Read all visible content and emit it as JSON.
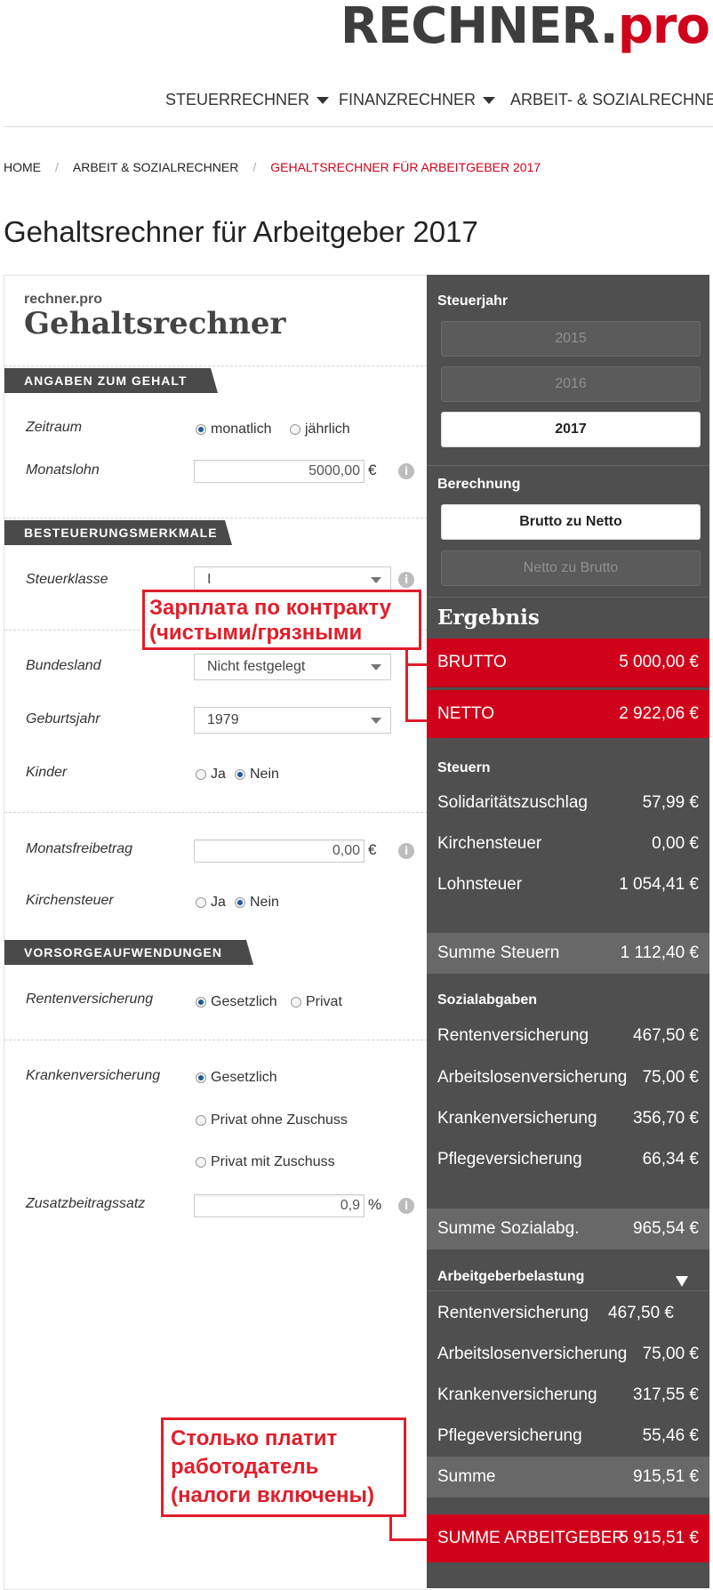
{
  "logo": {
    "dark": "RECHNER.",
    "red": "pro"
  },
  "nav": {
    "items": [
      "STEUERRECHNER",
      "FINANZRECHNER",
      "ARBEIT- & SOZIALRECHNER"
    ]
  },
  "breadcrumb": {
    "home": "HOME",
    "parent": "ARBEIT & SOZIALRECHNER",
    "current": "GEHALTSRECHNER FÜR ARBEITGEBER 2017"
  },
  "page_title": "Gehaltsrechner für Arbeitgeber 2017",
  "form": {
    "brand_small": "rechner.pro",
    "brand_big": "Gehaltsrechner",
    "sections": {
      "gehalt": "ANGABEN ZUM GEHALT",
      "besteuerung": "BESTEUERUNGSMERKMALE",
      "vorsorge": "VORSORGEAUFWENDUNGEN"
    },
    "zeitraum": {
      "label": "Zeitraum",
      "opt1": "monatlich",
      "opt2": "jährlich",
      "selected": "monatlich"
    },
    "monatslohn": {
      "label": "Monatslohn",
      "value": "5000,00",
      "unit": "€"
    },
    "steuerklasse": {
      "label": "Steuerklasse",
      "value": "I"
    },
    "bundesland": {
      "label": "Bundesland",
      "value": "Nicht festgelegt"
    },
    "geburtsjahr": {
      "label": "Geburtsjahr",
      "value": "1979"
    },
    "kinder": {
      "label": "Kinder",
      "opt1": "Ja",
      "opt2": "Nein",
      "selected": "Nein"
    },
    "monatsfreibetrag": {
      "label": "Monatsfreibetrag",
      "value": "0,00",
      "unit": "€"
    },
    "kirchensteuer": {
      "label": "Kirchensteuer",
      "opt1": "Ja",
      "opt2": "Nein",
      "selected": "Nein"
    },
    "renten": {
      "label": "Rentenversicherung",
      "opt1": "Gesetzlich",
      "opt2": "Privat",
      "selected": "Gesetzlich"
    },
    "kranken": {
      "label": "Krankenversicherung",
      "opt1": "Gesetzlich",
      "opt2": "Privat ohne Zuschuss",
      "opt3": "Privat mit Zuschuss",
      "selected": "Gesetzlich"
    },
    "zusatz": {
      "label": "Zusatzbeitragssatz",
      "value": "0,9",
      "unit": "%"
    },
    "info_glyph": "i"
  },
  "result": {
    "steuerjahr_label": "Steuerjahr",
    "years": [
      "2015",
      "2016",
      "2017"
    ],
    "selected_year": "2017",
    "berechnung_label": "Berechnung",
    "calc_options": [
      "Brutto zu Netto",
      "Netto zu Brutto"
    ],
    "selected_calc": "Brutto zu Netto",
    "ergebnis_label": "Ergebnis",
    "brutto": {
      "label": "BRUTTO",
      "value": "5 000,00 €"
    },
    "netto": {
      "label": "NETTO",
      "value": "2 922,06 €"
    },
    "steuern": {
      "title": "Steuern",
      "rows": [
        {
          "label": "Solidaritätszuschlag",
          "value": "57,99 €"
        },
        {
          "label": "Kirchensteuer",
          "value": "0,00 €"
        },
        {
          "label": "Lohnsteuer",
          "value": "1 054,41 €"
        }
      ],
      "sum": {
        "label": "Summe Steuern",
        "value": "1 112,40 €"
      }
    },
    "sozial": {
      "title": "Sozialabgaben",
      "rows": [
        {
          "label": "Rentenversicherung",
          "value": "467,50 €"
        },
        {
          "label": "Arbeitslosenversicherung",
          "value": "75,00 €"
        },
        {
          "label": "Krankenversicherung",
          "value": "356,70 €"
        },
        {
          "label": "Pflegeversicherung",
          "value": "66,34 €"
        }
      ],
      "sum": {
        "label": "Summe Sozialabg.",
        "value": "965,54 €"
      }
    },
    "arbeitgeber": {
      "title": "Arbeitgeberbelastung",
      "rows": [
        {
          "label": "Rentenversicherung",
          "value": "467,50 €"
        },
        {
          "label": "Arbeitslosenversicherung",
          "value": "75,00 €"
        },
        {
          "label": "Krankenversicherung",
          "value": "317,55 €"
        },
        {
          "label": "Pflegeversicherung",
          "value": "55,46 €"
        }
      ],
      "sum": {
        "label": "Summe",
        "value": "915,51 €"
      }
    },
    "total": {
      "label": "SUMME ARBEITGEBER",
      "value": "5 915,51 €"
    }
  },
  "annotations": {
    "contract": [
      "Зарплата по контракту",
      "(чистыми/грязными"
    ],
    "employer": [
      "Столько платит",
      "работодатель",
      "(налоги включены)"
    ]
  },
  "colors": {
    "accent": "#d0021b",
    "panel": "#4f4f4f",
    "annotation": "#e01e2a"
  }
}
